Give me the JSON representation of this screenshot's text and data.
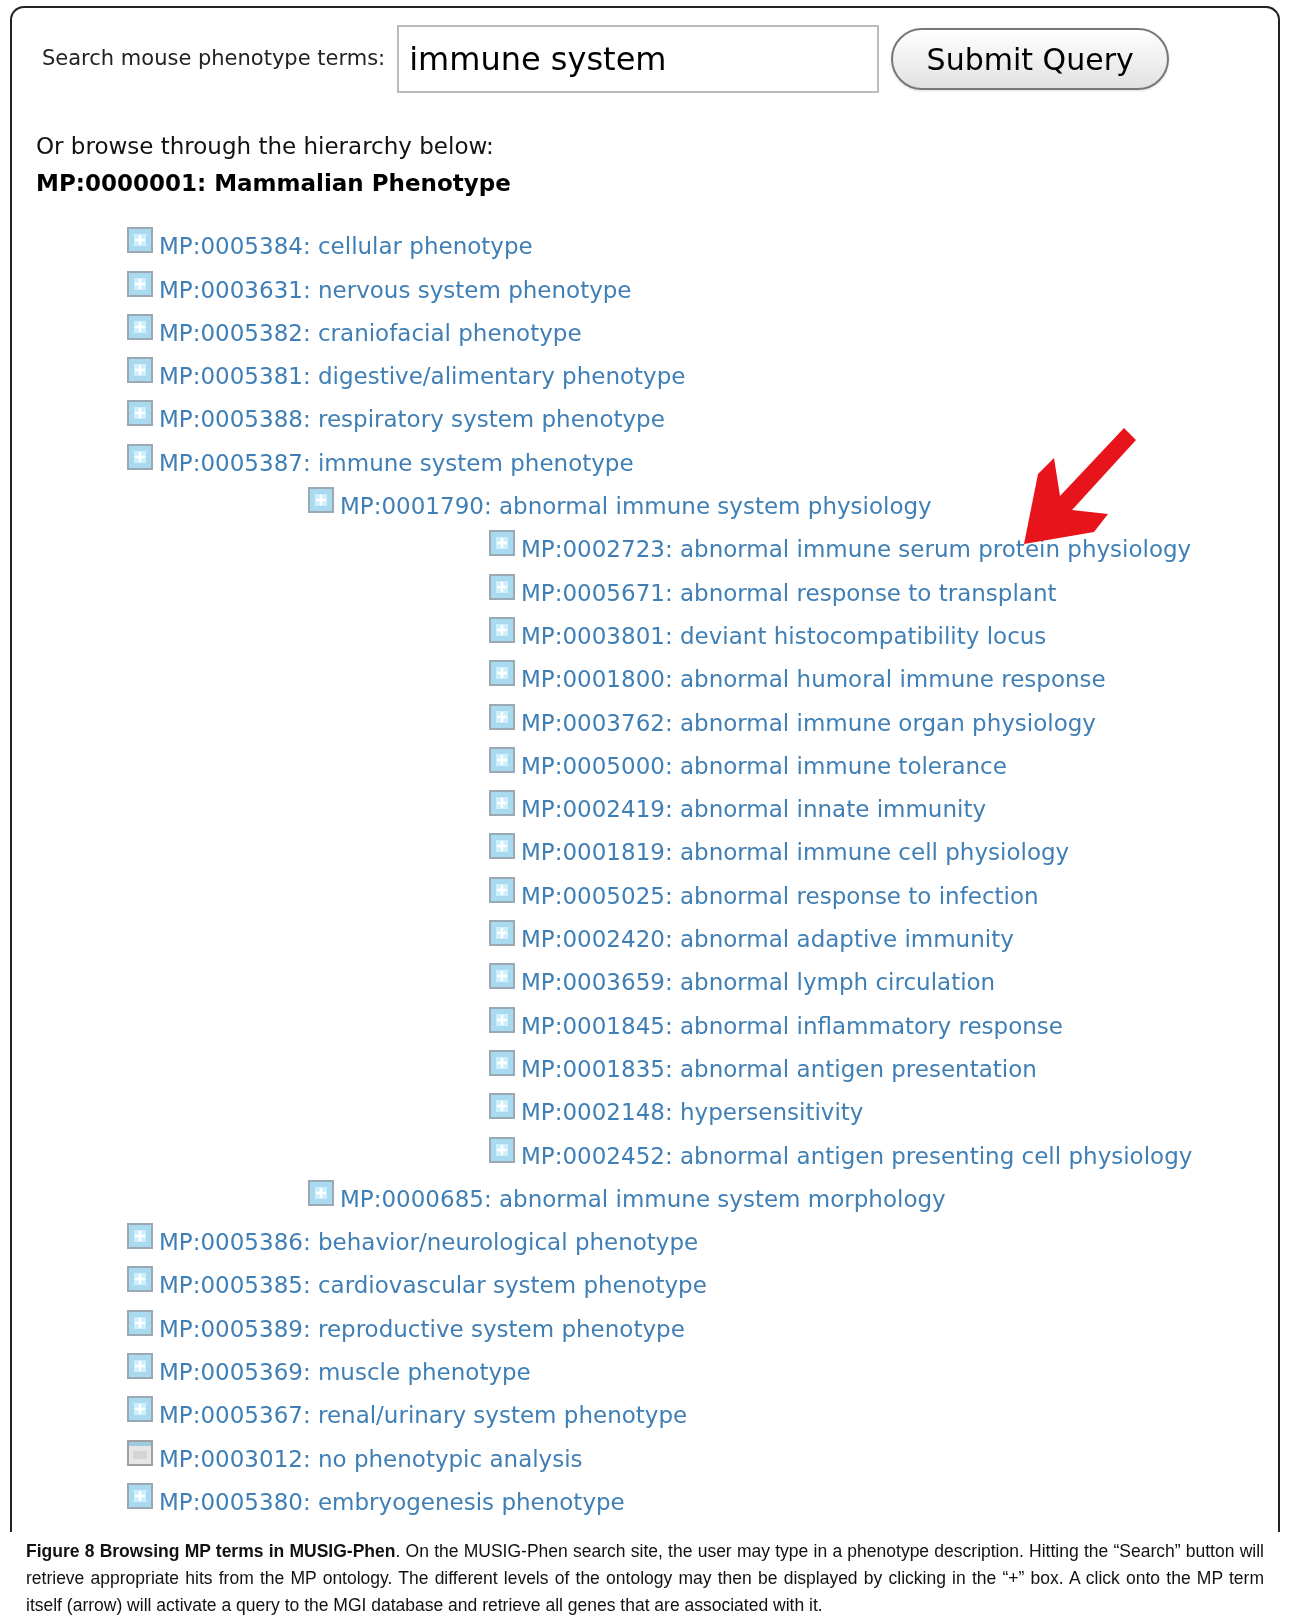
{
  "search": {
    "label": "Search mouse phenotype terms:",
    "value": "immune system",
    "button": "Submit Query"
  },
  "browse_hint": "Or browse through the hierarchy below:",
  "root": "MP:0000001: Mammalian Phenotype",
  "tree": [
    {
      "label": "MP:0005384: cellular phenotype",
      "kind": "plus"
    },
    {
      "label": "MP:0003631: nervous system phenotype",
      "kind": "plus"
    },
    {
      "label": "MP:0005382: craniofacial phenotype",
      "kind": "plus"
    },
    {
      "label": "MP:0005381: digestive/alimentary phenotype",
      "kind": "plus"
    },
    {
      "label": "MP:0005388: respiratory system phenotype",
      "kind": "plus"
    },
    {
      "label": "MP:0005387: immune system phenotype",
      "kind": "plus",
      "children": [
        {
          "label": "MP:0001790: abnormal immune system physiology",
          "kind": "plus",
          "children": [
            {
              "label": "MP:0002723: abnormal immune serum protein physiology",
              "kind": "plus"
            },
            {
              "label": "MP:0005671: abnormal response to transplant",
              "kind": "plus"
            },
            {
              "label": "MP:0003801: deviant histocompatibility locus",
              "kind": "plus"
            },
            {
              "label": "MP:0001800: abnormal humoral immune response",
              "kind": "plus"
            },
            {
              "label": "MP:0003762: abnormal immune organ physiology",
              "kind": "plus"
            },
            {
              "label": "MP:0005000: abnormal immune tolerance",
              "kind": "plus"
            },
            {
              "label": "MP:0002419: abnormal innate immunity",
              "kind": "plus"
            },
            {
              "label": "MP:0001819: abnormal immune cell physiology",
              "kind": "plus"
            },
            {
              "label": "MP:0005025: abnormal response to infection",
              "kind": "plus"
            },
            {
              "label": "MP:0002420: abnormal adaptive immunity",
              "kind": "plus"
            },
            {
              "label": "MP:0003659: abnormal lymph circulation",
              "kind": "plus"
            },
            {
              "label": "MP:0001845: abnormal inflammatory response",
              "kind": "plus"
            },
            {
              "label": "MP:0001835: abnormal antigen presentation",
              "kind": "plus"
            },
            {
              "label": "MP:0002148: hypersensitivity",
              "kind": "plus"
            },
            {
              "label": "MP:0002452: abnormal antigen presenting cell physiology",
              "kind": "plus"
            }
          ]
        },
        {
          "label": "MP:0000685: abnormal immune system morphology",
          "kind": "plus"
        }
      ]
    },
    {
      "label": "MP:0005386: behavior/neurological phenotype",
      "kind": "plus"
    },
    {
      "label": "MP:0005385: cardiovascular system phenotype",
      "kind": "plus"
    },
    {
      "label": "MP:0005389: reproductive system phenotype",
      "kind": "plus"
    },
    {
      "label": "MP:0005369: muscle phenotype",
      "kind": "plus"
    },
    {
      "label": "MP:0005367: renal/urinary system phenotype",
      "kind": "plus"
    },
    {
      "label": "MP:0003012: no phenotypic analysis",
      "kind": "empty"
    },
    {
      "label": "MP:0005380: embryogenesis phenotype",
      "kind": "plus"
    }
  ],
  "caption": "**Figure 8 Browsing MP terms in MUSIG-Phen**. On the MUSIG-Phen search site, the user may type in a phenotype description. Hitting the “Search” button will retrieve appropriate hits from the MP ontology. The different levels of the ontology may then be displayed by clicking in the “+” box. A click onto the MP term itself (arrow) will activate a query to the MGI database and retrieve all genes that are associated with it."
}
